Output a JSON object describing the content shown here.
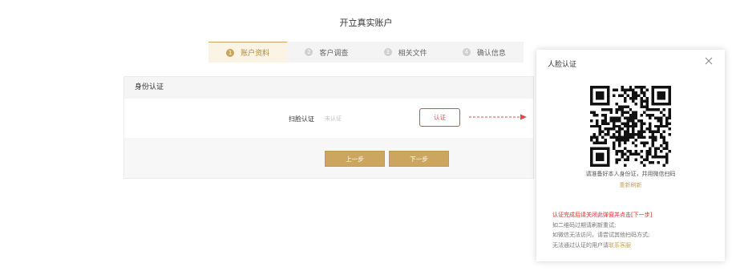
{
  "page": {
    "title": "开立真实账户"
  },
  "steps": [
    {
      "num": "1",
      "label": "账户资料",
      "active": true
    },
    {
      "num": "2",
      "label": "客户调查",
      "active": false
    },
    {
      "num": "3",
      "label": "相关文件",
      "active": false
    },
    {
      "num": "4",
      "label": "确认信息",
      "active": false
    }
  ],
  "section": {
    "title": "身份认证",
    "scan_label": "扫脸认证",
    "scan_status": "未认证",
    "auth_button": "认证"
  },
  "nav": {
    "prev": "上一步",
    "next": "下一步"
  },
  "modal": {
    "title": "人脸认证",
    "qr_hint": "请准备好本人身份证，并用微信扫码",
    "refresh": "重新刷新",
    "note_red": "认证完成后请关闭此弹窗并点击[下一步]",
    "note_1": "如二维码过期请刷新重试;",
    "note_2": "如微信无法访问，请尝试其他扫码方式;",
    "note_3_prefix": "无法通过认证的用户请",
    "contact": "联系客服"
  },
  "colors": {
    "accent_gold": "#c9a45a",
    "alert_red": "#d94c4c"
  }
}
